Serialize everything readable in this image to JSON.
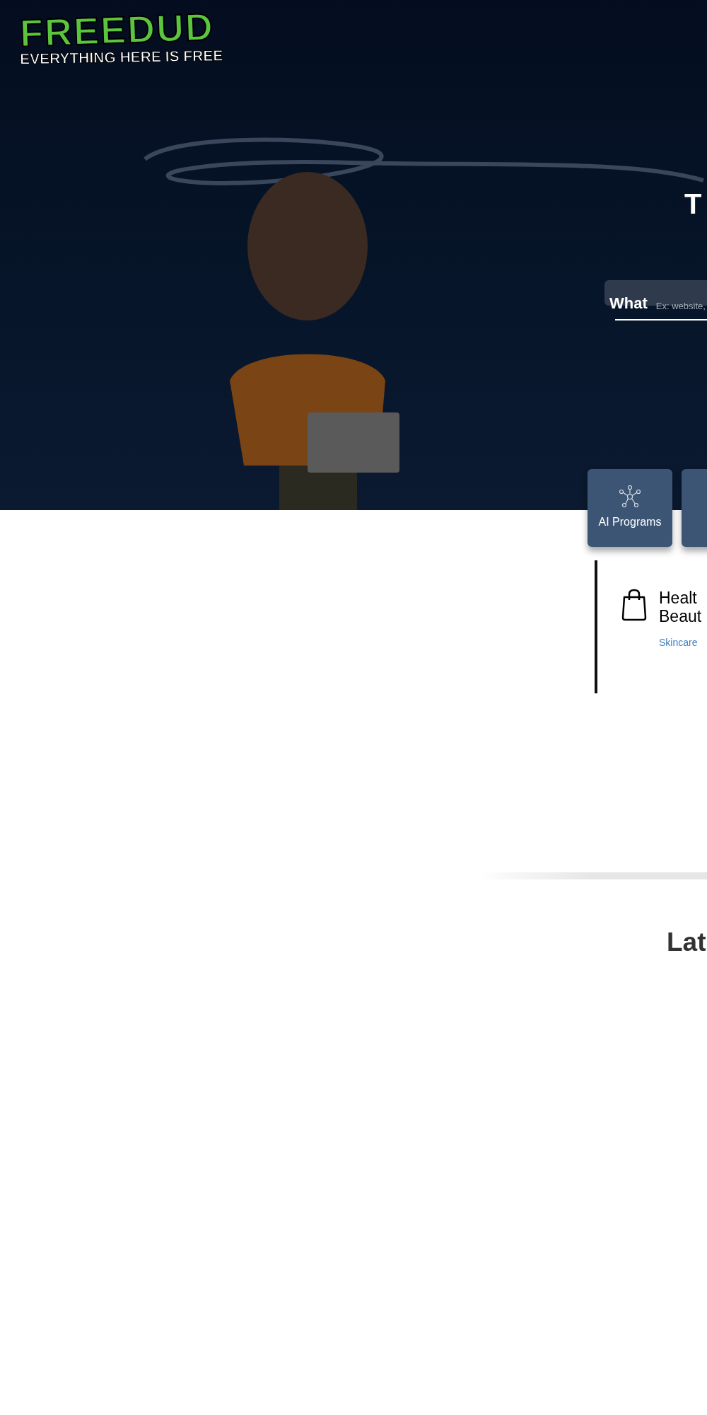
{
  "logo": {
    "title": "FREEDUD",
    "tagline": "EVERYTHING HERE IS FREE"
  },
  "hero": {
    "title": "T",
    "search": {
      "label": "What",
      "placeholder": "Ex: website,"
    }
  },
  "categories": [
    {
      "label": "AI Programs"
    }
  ],
  "featured": {
    "title_lines": [
      "Healt",
      "Beaut"
    ],
    "link": "Skincare"
  },
  "latest": {
    "title": "Lat"
  }
}
